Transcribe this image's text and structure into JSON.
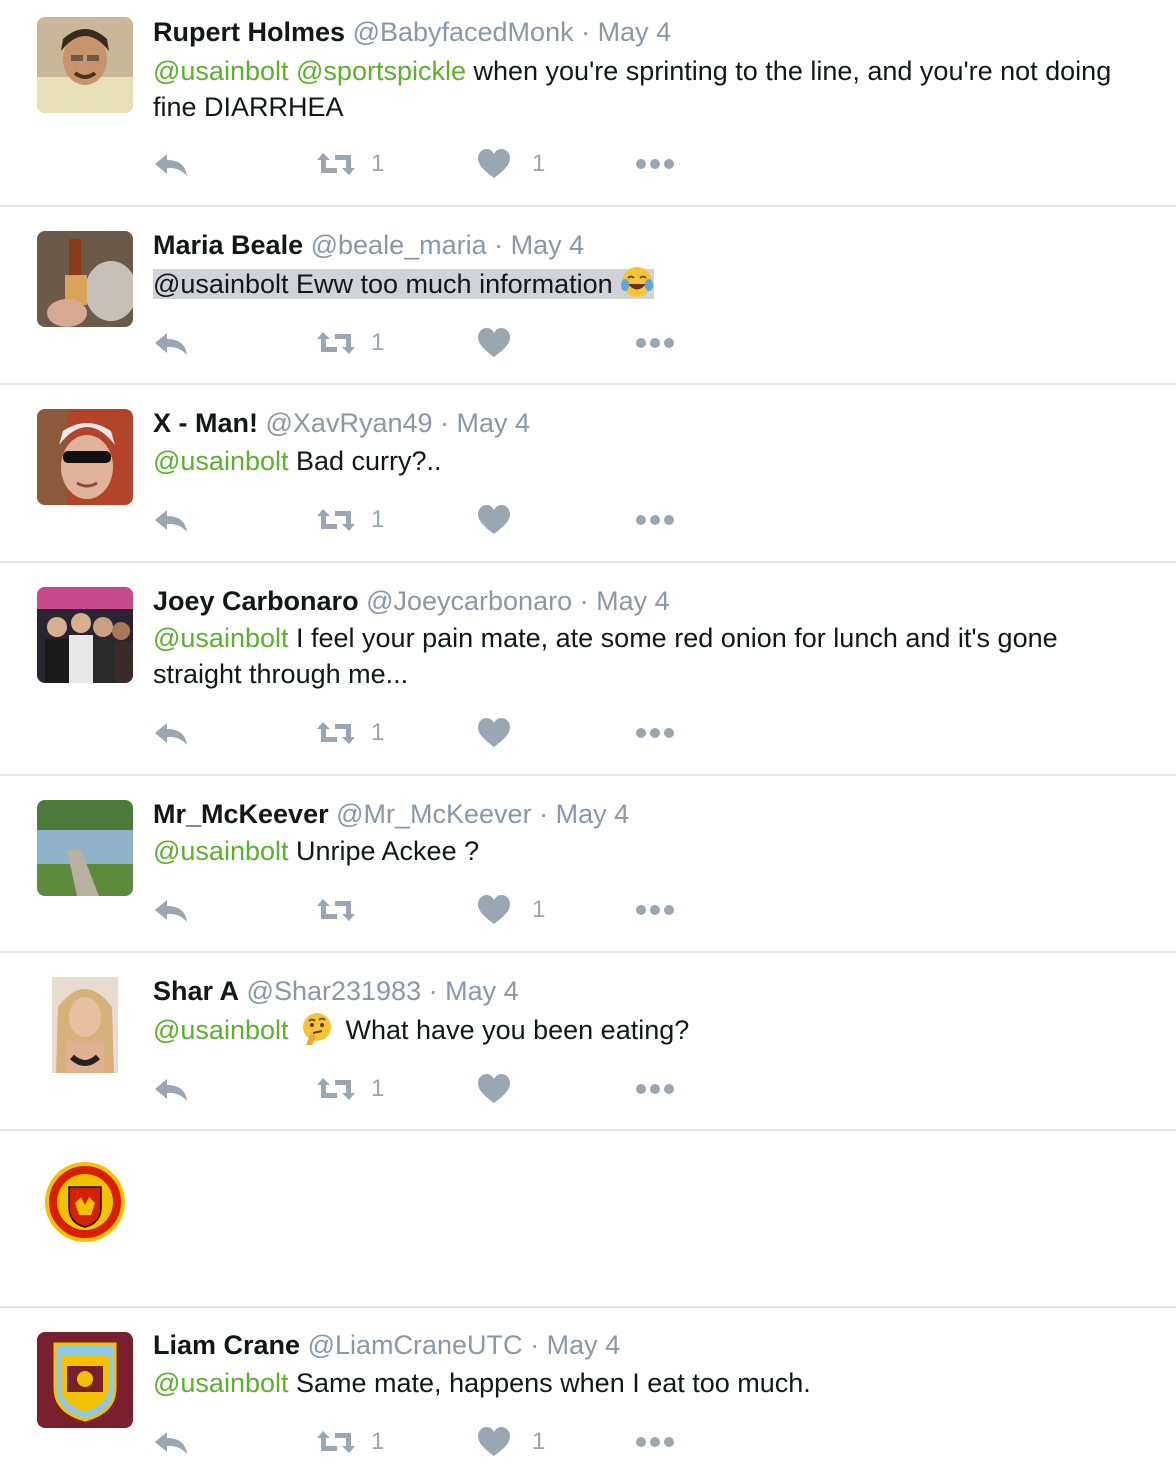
{
  "tweets": [
    {
      "name": "Rupert Holmes",
      "handle": "@BabyfacedMonk",
      "sep": "·",
      "date": "May 4",
      "mentions": [
        "@usainbolt",
        "@sportspickle"
      ],
      "text": " when you're sprinting to the line, and you're not doing fine DIARRHEA",
      "retweets": "1",
      "likes": "1"
    },
    {
      "name": "Maria Beale",
      "handle": "@beale_maria",
      "sep": "·",
      "date": "May 4",
      "mentions": [
        "@usainbolt"
      ],
      "text": " Eww too much information ",
      "emoji": "tears-of-joy-emoji",
      "retweets": "1",
      "likes": ""
    },
    {
      "name": "X - Man!",
      "handle": "@XavRyan49",
      "sep": "·",
      "date": "May 4",
      "mentions": [
        "@usainbolt"
      ],
      "text": " Bad curry?..",
      "retweets": "1",
      "likes": ""
    },
    {
      "name": "Joey Carbonaro",
      "handle": "@Joeycarbonaro",
      "sep": "·",
      "date": "May 4",
      "mentions": [
        "@usainbolt"
      ],
      "text": " I feel your pain mate, ate some red onion for lunch and it's gone straight through me...",
      "retweets": "1",
      "likes": ""
    },
    {
      "name": "Mr_McKeever",
      "handle": "@Mr_McKeever",
      "sep": "·",
      "date": "May 4",
      "mentions": [
        "@usainbolt"
      ],
      "text": " Unripe Ackee ?",
      "retweets": "",
      "likes": "1"
    },
    {
      "name": "Shar A",
      "handle": "@Shar231983",
      "sep": "·",
      "date": "May 4",
      "mentions": [
        "@usainbolt"
      ],
      "text": " What have you been eating?",
      "emoji": "thinking-face-emoji",
      "retweets": "1",
      "likes": ""
    },
    {
      "name": "Liam Crane",
      "handle": "@LiamCraneUTC",
      "sep": "·",
      "date": "May 4",
      "mentions": [
        "@usainbolt"
      ],
      "text": " Same mate, happens when I eat too much.",
      "retweets": "1",
      "likes": "1"
    }
  ],
  "colors": {
    "mention": "#5cb02c",
    "meta": "#8a98a5",
    "icon": "#9aa6b2",
    "divider": "#e1e8ed"
  },
  "icons": [
    "reply-icon",
    "retweet-icon",
    "like-icon",
    "more-icon"
  ]
}
